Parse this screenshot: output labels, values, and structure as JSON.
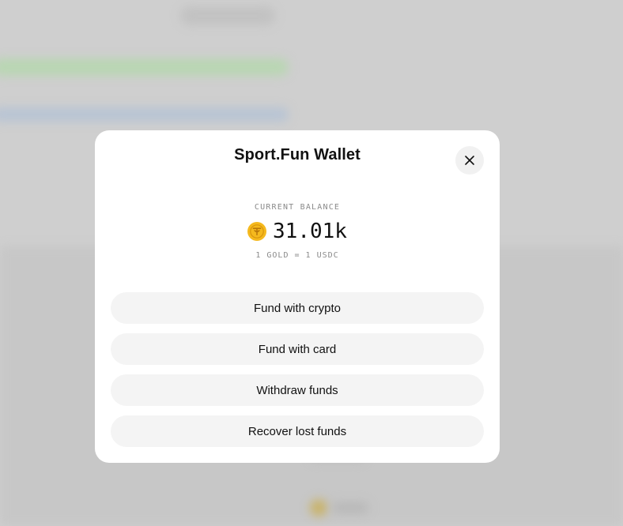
{
  "modal": {
    "title": "Sport.Fun Wallet",
    "close_icon": "close-icon",
    "balance_label": "CURRENT BALANCE",
    "balance_value": "31.01k",
    "coin_icon": "gold-coin-icon",
    "rate_text": "1 GOLD = 1 USDC",
    "actions": [
      {
        "label": "Fund with crypto"
      },
      {
        "label": "Fund with card"
      },
      {
        "label": "Withdraw funds"
      },
      {
        "label": "Recover lost funds"
      }
    ]
  },
  "colors": {
    "modal_bg": "#ffffff",
    "backdrop": "#cfcfcf",
    "button_bg": "#f4f4f4",
    "coin": "#f5b91e",
    "text_primary": "#111111",
    "text_muted": "#8a8a8a"
  }
}
